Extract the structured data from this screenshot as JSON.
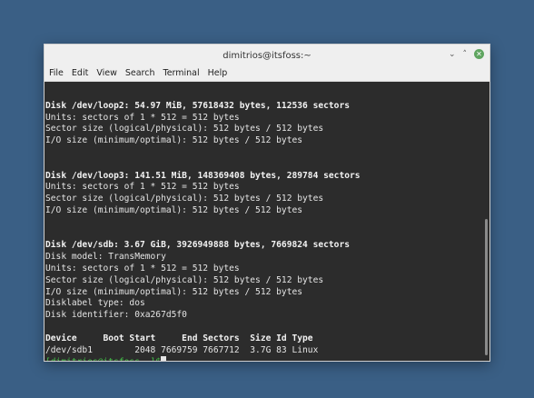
{
  "window": {
    "title": "dimitrios@itsfoss:~",
    "controls": {
      "minimize": "⌄",
      "maximize": "˄",
      "close": "✕"
    }
  },
  "menu": [
    "File",
    "Edit",
    "View",
    "Search",
    "Terminal",
    "Help"
  ],
  "terminal": {
    "lines": [
      {
        "text": "",
        "style": "normal"
      },
      {
        "text": "Disk /dev/loop2: 54.97 MiB, 57618432 bytes, 112536 sectors",
        "style": "bold"
      },
      {
        "text": "Units: sectors of 1 * 512 = 512 bytes",
        "style": "normal"
      },
      {
        "text": "Sector size (logical/physical): 512 bytes / 512 bytes",
        "style": "normal"
      },
      {
        "text": "I/O size (minimum/optimal): 512 bytes / 512 bytes",
        "style": "normal"
      },
      {
        "text": "",
        "style": "normal"
      },
      {
        "text": "",
        "style": "normal"
      },
      {
        "text": "Disk /dev/loop3: 141.51 MiB, 148369408 bytes, 289784 sectors",
        "style": "bold"
      },
      {
        "text": "Units: sectors of 1 * 512 = 512 bytes",
        "style": "normal"
      },
      {
        "text": "Sector size (logical/physical): 512 bytes / 512 bytes",
        "style": "normal"
      },
      {
        "text": "I/O size (minimum/optimal): 512 bytes / 512 bytes",
        "style": "normal"
      },
      {
        "text": "",
        "style": "normal"
      },
      {
        "text": "",
        "style": "normal"
      },
      {
        "text": "Disk /dev/sdb: 3.67 GiB, 3926949888 bytes, 7669824 sectors",
        "style": "bold"
      },
      {
        "text": "Disk model: TransMemory",
        "style": "normal"
      },
      {
        "text": "Units: sectors of 1 * 512 = 512 bytes",
        "style": "normal"
      },
      {
        "text": "Sector size (logical/physical): 512 bytes / 512 bytes",
        "style": "normal"
      },
      {
        "text": "I/O size (minimum/optimal): 512 bytes / 512 bytes",
        "style": "normal"
      },
      {
        "text": "Disklabel type: dos",
        "style": "normal"
      },
      {
        "text": "Disk identifier: 0xa267d5f0",
        "style": "normal"
      },
      {
        "text": "",
        "style": "normal"
      },
      {
        "text": "Device     Boot Start     End Sectors  Size Id Type",
        "style": "bold"
      },
      {
        "text": "/dev/sdb1        2048 7669759 7667712  3.7G 83 Linux",
        "style": "normal"
      }
    ],
    "prompt": "[dimitrios@itsfoss ~]$",
    "colors": {
      "background": "#2c2c2c",
      "text": "#e4e4e4",
      "prompt": "#45c04a"
    }
  }
}
